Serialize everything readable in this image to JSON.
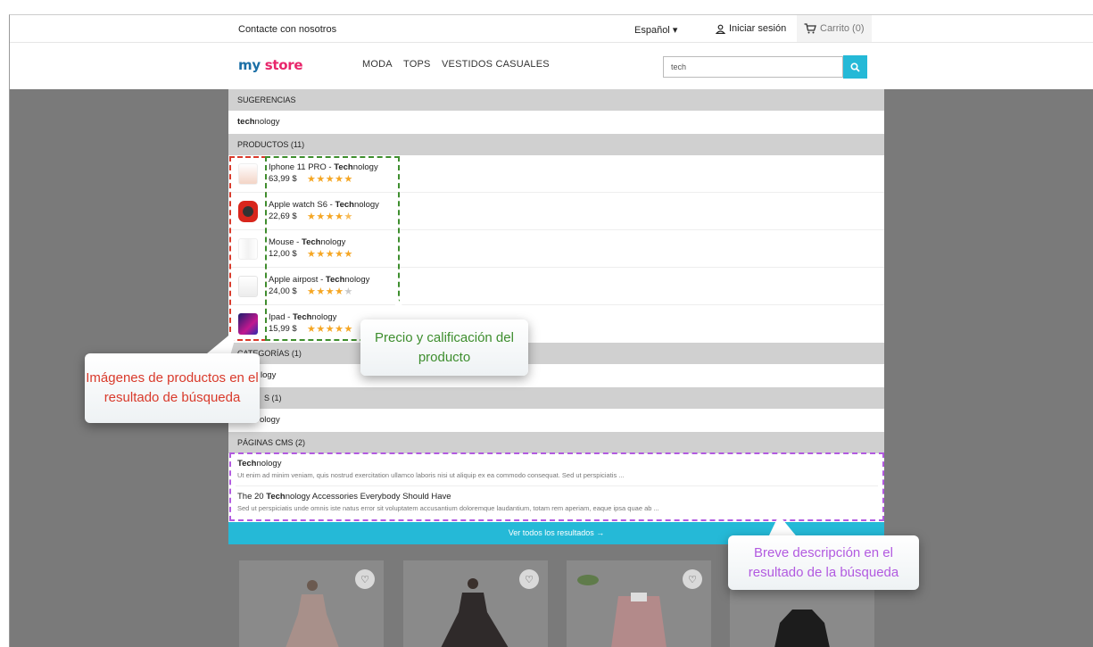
{
  "topbar": {
    "contact": "Contacte con nosotros",
    "language": "Español",
    "signin": "Iniciar sesión",
    "cart": "Carrito (0)"
  },
  "header": {
    "logo_part1": "my",
    "logo_part2": "store",
    "nav": [
      "MODA",
      "TOPS",
      "VESTIDOS CASUALES"
    ],
    "search_value": "tech"
  },
  "dropdown": {
    "suggestions_header": "SUGERENCIAS",
    "suggestion": {
      "bold": "tech",
      "rest": "nology"
    },
    "products_header": "PRODUCTOS (11)",
    "products": [
      {
        "name": "Iphone 11 PRO - ",
        "bold": "Tech",
        "rest": "nology",
        "price": "63,99 $",
        "rating": 5
      },
      {
        "name": "Apple watch S6 - ",
        "bold": "Tech",
        "rest": "nology",
        "price": "22,69 $",
        "rating": 4.5
      },
      {
        "name": "Mouse - ",
        "bold": "Tech",
        "rest": "nology",
        "price": "12,00 $",
        "rating": 5
      },
      {
        "name": "Apple airpost - ",
        "bold": "Tech",
        "rest": "nology",
        "price": "24,00 $",
        "rating": 4
      },
      {
        "name": "Ipad - ",
        "bold": "Tech",
        "rest": "nology",
        "price": "15,99 $",
        "rating": 5
      }
    ],
    "categories_header": "CATEGORÍAS (1)",
    "categories_item": "logy",
    "brands_header": "S (1)",
    "brands_item": "ology",
    "cms_header": "PÁGINAS CMS (2)",
    "cms": [
      {
        "pre": "",
        "bold": "Tech",
        "rest": "nology",
        "desc": "Ut enim ad minim veniam, quis nostrud exercitation ullamco laboris nisi ut aliquip ex ea commodo consequat. Sed ut perspiciatis ..."
      },
      {
        "pre": "The 20 ",
        "bold": "Tech",
        "rest": "nology Accessories Everybody Should Have",
        "desc": "Sed ut perspiciatis unde omnis iste natus error sit voluptatem accusantium doloremque laudantium, totam rem aperiam, eaque ipsa quae ab ..."
      }
    ],
    "view_all": "Ver todos los resultados →"
  },
  "callouts": {
    "images": "Imágenes de productos en el resultado de búsqueda",
    "price": "Precio y calificación del producto",
    "desc": "Breve descripción en el resultado de la búsqueda"
  },
  "colors": {
    "accent": "#25b9d7",
    "red_callout": "#d93a2b",
    "green_callout": "#3e8e2e",
    "purple_callout": "#b25ae0",
    "star": "#f5a623"
  }
}
